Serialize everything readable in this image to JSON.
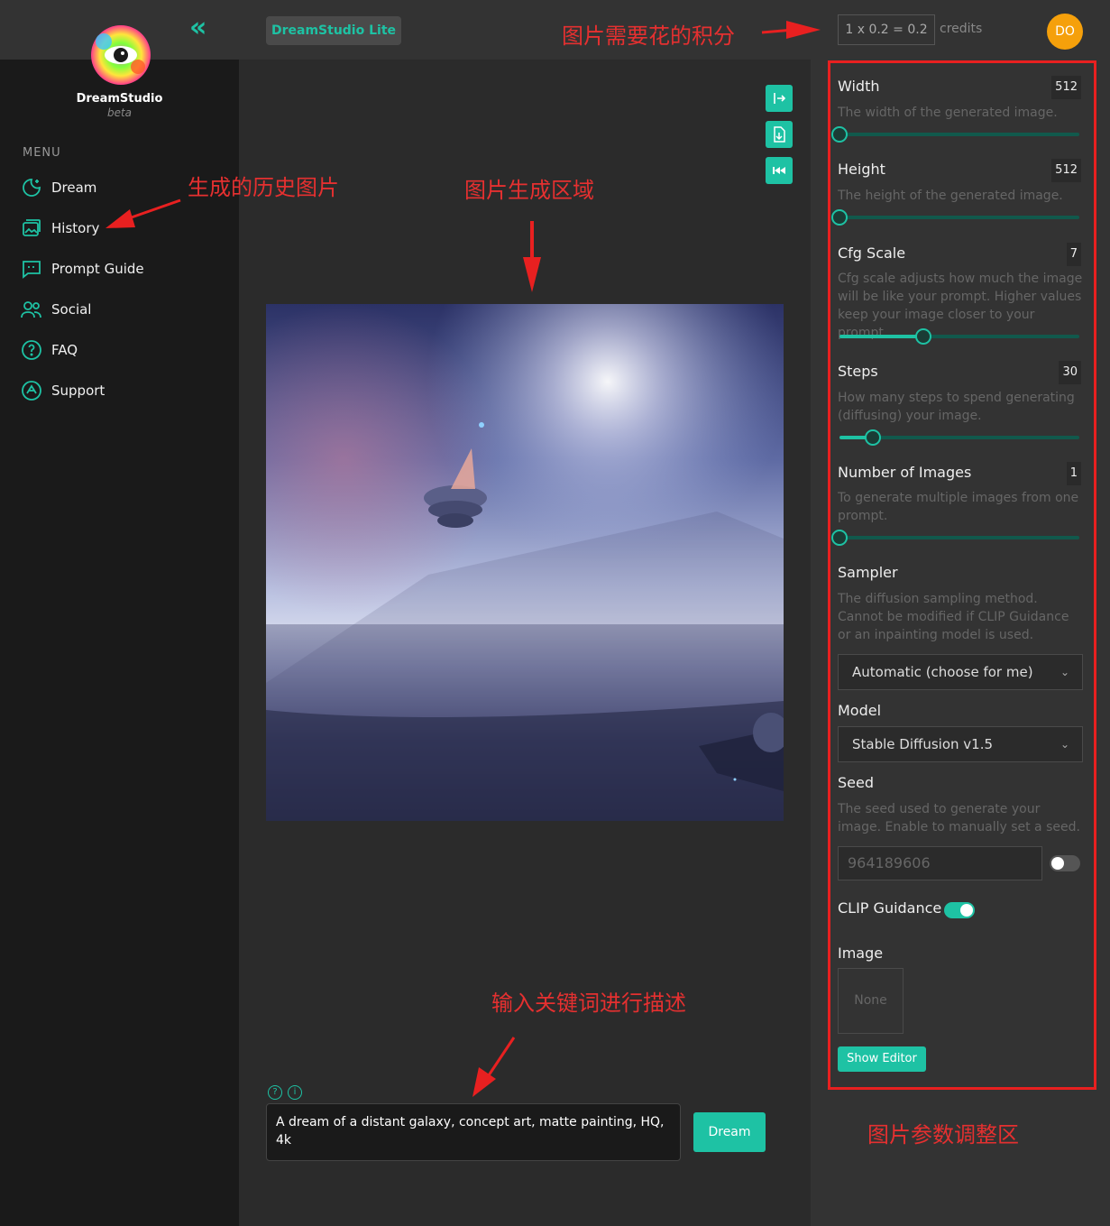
{
  "topbar": {
    "lite_label": "DreamStudio Lite",
    "credit_formula": "1 x 0.2 = 0.2",
    "credit_label": "credits",
    "avatar_initials": "DO"
  },
  "sidebar": {
    "brand": "DreamStudio",
    "brand_sub": "beta",
    "menu_label": "MENU",
    "items": [
      {
        "label": "Dream",
        "icon": "dream-icon"
      },
      {
        "label": "History",
        "icon": "history-icon"
      },
      {
        "label": "Prompt Guide",
        "icon": "prompt-guide-icon"
      },
      {
        "label": "Social",
        "icon": "social-icon"
      },
      {
        "label": "FAQ",
        "icon": "faq-icon"
      },
      {
        "label": "Support",
        "icon": "support-icon"
      }
    ]
  },
  "main": {
    "prompt_text": "A dream of a distant galaxy, concept art, matte painting, HQ, 4k",
    "dream_button": "Dream"
  },
  "panel": {
    "width": {
      "title": "Width",
      "value": "512",
      "desc": "The width of the generated image.",
      "level": 0
    },
    "height": {
      "title": "Height",
      "value": "512",
      "desc": "The height of the generated image.",
      "level": 0
    },
    "cfg": {
      "title": "Cfg Scale",
      "value": "7",
      "desc": "Cfg scale adjusts how much the image will be like your prompt. Higher values keep your image closer to your prompt.",
      "level": 0.35
    },
    "steps": {
      "title": "Steps",
      "value": "30",
      "desc": "How many steps to spend generating (diffusing) your image.",
      "level": 0.14
    },
    "num_images": {
      "title": "Number of Images",
      "value": "1",
      "desc": "To generate multiple images from one prompt.",
      "level": 0
    },
    "sampler": {
      "title": "Sampler",
      "desc": "The diffusion sampling method. Cannot be modified if CLIP Guidance or an inpainting model is used.",
      "selected": "Automatic (choose for me)"
    },
    "model": {
      "title": "Model",
      "selected": "Stable Diffusion v1.5"
    },
    "seed": {
      "title": "Seed",
      "desc": "The seed used to generate your image. Enable to manually set a seed.",
      "value": "964189606",
      "enabled": false
    },
    "clip": {
      "title": "CLIP Guidance",
      "enabled": true
    },
    "image": {
      "title": "Image",
      "placeholder": "None"
    },
    "show_editor": "Show Editor"
  },
  "annotations": {
    "credits_note": "图片需要花的积分",
    "history_note": "生成的历史图片",
    "canvas_note": "图片生成区域",
    "prompt_note": "输入关键词进行描述",
    "params_note": "图片参数调整区"
  },
  "colors": {
    "accent": "#1ec2a4",
    "annotation": "#e53030",
    "avatar": "#f5a00b"
  }
}
